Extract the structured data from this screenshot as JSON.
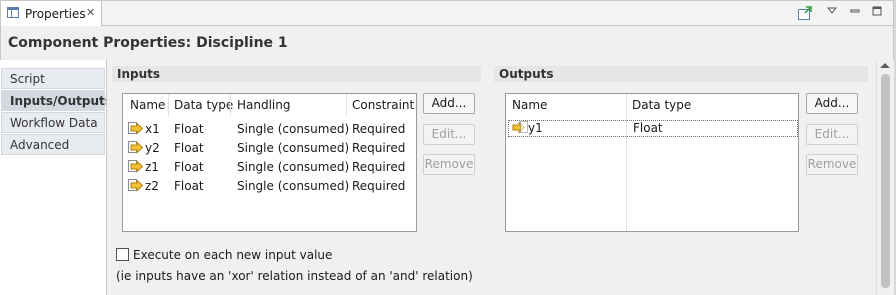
{
  "view_tab": {
    "label": "Properties",
    "close": "✕"
  },
  "title": "Component Properties: Discipline 1",
  "side_tabs": [
    "Script",
    "Inputs/Outputs",
    "Workflow Data",
    "Advanced"
  ],
  "inputs": {
    "header": "Inputs",
    "columns": [
      "Name",
      "Data type",
      "Handling",
      "Constraint"
    ],
    "rows": [
      {
        "name": "x1",
        "type": "Float",
        "handling": "Single (consumed)",
        "constraint": "Required"
      },
      {
        "name": "y2",
        "type": "Float",
        "handling": "Single (consumed)",
        "constraint": "Required"
      },
      {
        "name": "z1",
        "type": "Float",
        "handling": "Single (consumed)",
        "constraint": "Required"
      },
      {
        "name": "z2",
        "type": "Float",
        "handling": "Single (consumed)",
        "constraint": "Required"
      }
    ],
    "buttons": {
      "add": "Add...",
      "edit": "Edit...",
      "remove": "Remove"
    }
  },
  "outputs": {
    "header": "Outputs",
    "columns": [
      "Name",
      "Data type"
    ],
    "rows": [
      {
        "name": "y1",
        "type": "Float"
      }
    ],
    "buttons": {
      "add": "Add...",
      "edit": "Edit...",
      "remove": "Remove"
    }
  },
  "execute_checkbox": {
    "label": "Execute on each new input value",
    "checked": false
  },
  "note": "(ie inputs have an 'xor' relation instead of an 'and' relation)",
  "colors": {
    "accent": "#5a7fa8",
    "input_icon": "#e8b020"
  }
}
